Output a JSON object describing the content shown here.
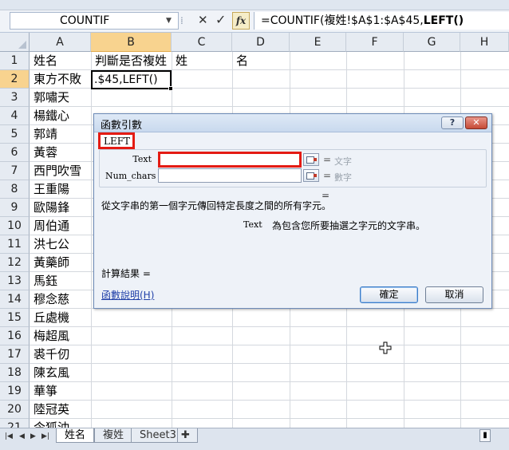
{
  "formula_bar": {
    "name_box": "COUNTIF",
    "formula_prefix": "=COUNTIF(複姓!$A$1:$A$45,",
    "formula_bold": "LEFT()",
    "fx_label": "fx"
  },
  "columns": [
    "A",
    "B",
    "C",
    "D",
    "E",
    "F",
    "G",
    "H"
  ],
  "rows": [
    "1",
    "2",
    "3",
    "4",
    "5",
    "6",
    "7",
    "8",
    "9",
    "10",
    "11",
    "12",
    "13",
    "14",
    "15",
    "16",
    "17",
    "18",
    "19",
    "20",
    "21",
    "22"
  ],
  "cells": {
    "header_a": "姓名",
    "header_b": "判斷是否複姓",
    "header_c": "姓",
    "header_d": "名",
    "active_b2": ".$45,LEFT()",
    "names": [
      "東方不敗",
      "郭嘯天",
      "楊鐵心",
      "郭靖",
      "黃蓉",
      "西門吹雪",
      "王重陽",
      "歐陽鋒",
      "周伯通",
      "洪七公",
      "黃藥師",
      "馬鈺",
      "穆念慈",
      "丘處機",
      "梅超風",
      "裘千仞",
      "陳玄風",
      "華箏",
      "陸冠英",
      "令狐沖"
    ]
  },
  "sheet_tabs": [
    "姓名",
    "複姓",
    "Sheet3"
  ],
  "dialog": {
    "title": "函數引數",
    "function_name": "LEFT",
    "help_btn": "?",
    "close_btn": "✕",
    "args": [
      {
        "label": "Text",
        "value": "",
        "result": "文字"
      },
      {
        "label": "Num_chars",
        "value": "",
        "result": "數字"
      }
    ],
    "eq_sign": "=",
    "function_description": "從文字串的第一個字元傳回特定長度之間的所有字元。",
    "arg_desc_name": "Text",
    "arg_description": "為包含您所要抽選之字元的文字串。",
    "calc_result": "計算結果 =",
    "help_link": "函數說明(H)",
    "ok": "確定",
    "cancel": "取消"
  }
}
